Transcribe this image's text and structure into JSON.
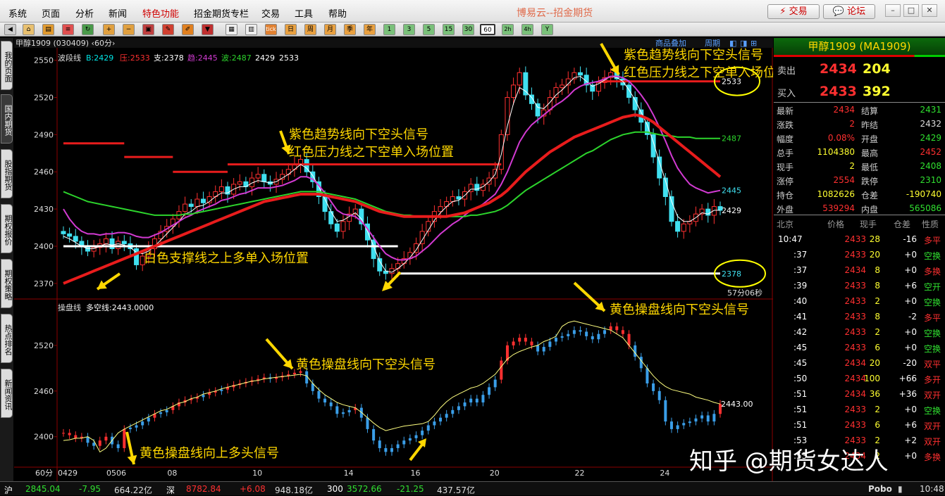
{
  "menu": {
    "items": [
      "系统",
      "页面",
      "分析",
      "新闻",
      "特色功能",
      "招金期货专栏",
      "交易",
      "工具",
      "帮助"
    ],
    "app_title": "博易云--招金期货",
    "trade_button": "交易",
    "forum_button": "论坛"
  },
  "toolbar": {
    "period_buttons": [
      "1",
      "3",
      "5",
      "15",
      "30",
      "60",
      "2h",
      "4h",
      "Y"
    ],
    "tick_button": "tick",
    "day_button": "日",
    "week_button": "周",
    "month_button": "月",
    "season_button": "季",
    "year_button": "年"
  },
  "sidebar": {
    "tabs": [
      "我的页面",
      "国内期货",
      "股指期货",
      "期权报价",
      "期权策略",
      "热点排名",
      "新闻资讯"
    ]
  },
  "chart": {
    "main_title": "甲醇1909 (030409) ‹60分›",
    "main_indicator": {
      "name": "波段线",
      "items": [
        {
          "label": "B:2429",
          "color": "#00e5e5"
        },
        {
          "label": "压:2533",
          "color": "#ff3030"
        },
        {
          "label": "支:2378",
          "color": "#ffffff"
        },
        {
          "label": "趋:2445",
          "color": "#d23ad2"
        },
        {
          "label": "波:2487",
          "color": "#2cd42c"
        },
        {
          "label": "2429",
          "color": "#ffffff"
        },
        {
          "label": "2533",
          "color": "#ffffff"
        }
      ]
    },
    "overlay_links": [
      "商品叠加",
      "周期"
    ],
    "sub_indicator": {
      "name": "操盘线",
      "items": [
        {
          "label": "多空线:2443.0000",
          "color": "#ffffff"
        }
      ]
    },
    "countdown": "57分06秒",
    "period_label": "60分",
    "main_axis_ticks": [
      2550,
      2520,
      2490,
      2460,
      2430,
      2400,
      2370
    ],
    "sub_axis_ticks": [
      2520,
      2460,
      2400
    ],
    "x_labels": [
      "0429",
      "0506",
      "08",
      "10",
      "14",
      "16",
      "20",
      "22",
      "24"
    ],
    "right_labels": {
      "resistance": "2533",
      "wave": "2487",
      "trend": "2445",
      "price": "2429",
      "support": "2378",
      "sub_line": "2443.00"
    },
    "annotations": [
      {
        "text": "紫色趋势线向下空头信号",
        "color": "#ffd700"
      },
      {
        "text": "红色压力线之下空单入场位置",
        "color": "#ffd700"
      },
      {
        "text": "白色支撑线之上多单入场位置",
        "color": "#ffd700"
      },
      {
        "text": "紫色趋势线向下空头信号",
        "color": "#ffd700"
      },
      {
        "text": "红色压力线之下空单入场位置",
        "color": "#ffd700"
      },
      {
        "text": "黄色操盘线向下空头信号",
        "color": "#ffd700"
      },
      {
        "text": "黄色操盘线向下空头信号",
        "color": "#ffd700"
      },
      {
        "text": "黄色操盘线向上多头信号",
        "color": "#ffd700"
      }
    ]
  },
  "chart_data": {
    "type": "line",
    "title": "甲醇1909 (030409) ‹60分›",
    "xlabel": "",
    "ylabel": "",
    "ylim": [
      2358,
      2560
    ],
    "x_labels": [
      "0429",
      "0506",
      "08",
      "10",
      "14",
      "16",
      "20",
      "22",
      "24"
    ],
    "candles_close": [
      2410,
      2408,
      2404,
      2400,
      2396,
      2399,
      2402,
      2406,
      2398,
      2404,
      2402,
      2398,
      2385,
      2392,
      2398,
      2406,
      2412,
      2416,
      2422,
      2428,
      2434,
      2432,
      2438,
      2435,
      2440,
      2444,
      2448,
      2442,
      2450,
      2452,
      2448,
      2455,
      2458,
      2452,
      2450,
      2454,
      2458,
      2462,
      2466,
      2470,
      2460,
      2452,
      2440,
      2428,
      2418,
      2412,
      2420,
      2426,
      2430,
      2418,
      2405,
      2390,
      2380,
      2378,
      2382,
      2386,
      2390,
      2395,
      2402,
      2412,
      2420,
      2428,
      2432,
      2436,
      2440,
      2438,
      2444,
      2450,
      2445,
      2450,
      2455,
      2462,
      2490,
      2520,
      2530,
      2540,
      2522,
      2515,
      2505,
      2510,
      2520,
      2528,
      2530,
      2535,
      2540,
      2538,
      2530,
      2525,
      2532,
      2536,
      2540,
      2535,
      2530,
      2520,
      2510,
      2500,
      2490,
      2472,
      2455,
      2440,
      2420,
      2412,
      2418,
      2420,
      2426,
      2430,
      2425,
      2432,
      2429
    ],
    "series": [
      {
        "name": "B",
        "color": "#ffffff",
        "values": [
          2408,
          2406,
          2403,
          2400,
          2398,
          2398,
          2400,
          2402,
          2401,
          2402,
          2401,
          2399,
          2395,
          2394,
          2396,
          2400,
          2405,
          2410,
          2415,
          2420,
          2426,
          2428,
          2432,
          2433,
          2436,
          2440,
          2443,
          2443,
          2446,
          2448,
          2448,
          2451,
          2453,
          2452,
          2451,
          2452,
          2455,
          2458,
          2462,
          2466,
          2463,
          2457,
          2448,
          2438,
          2428,
          2420,
          2421,
          2424,
          2427,
          2422,
          2412,
          2400,
          2388,
          2380,
          2379,
          2382,
          2386,
          2391,
          2397,
          2405,
          2413,
          2421,
          2427,
          2432,
          2436,
          2437,
          2441,
          2446,
          2446,
          2448,
          2452,
          2458,
          2474,
          2497,
          2515,
          2528,
          2525,
          2520,
          2512,
          2511,
          2516,
          2522,
          2526,
          2531,
          2536,
          2537,
          2533,
          2529,
          2531,
          2534,
          2537,
          2536,
          2533,
          2526,
          2518,
          2508,
          2498,
          2484,
          2468,
          2453,
          2436,
          2424,
          2420,
          2420,
          2423,
          2427,
          2426,
          2429,
          2429
        ]
      },
      {
        "name": "趋",
        "color": "#d23ad2",
        "values": [
          2430,
          2422,
          2416,
          2412,
          2410,
          2410,
          2409,
          2410,
          2410,
          2411,
          2411,
          2410,
          2408,
          2407,
          2407,
          2409,
          2411,
          2414,
          2417,
          2420,
          2423,
          2425,
          2428,
          2430,
          2432,
          2434,
          2437,
          2438,
          2440,
          2442,
          2443,
          2445,
          2447,
          2447,
          2447,
          2448,
          2449,
          2451,
          2453,
          2456,
          2456,
          2454,
          2449,
          2443,
          2436,
          2429,
          2426,
          2425,
          2424,
          2420,
          2414,
          2407,
          2400,
          2394,
          2391,
          2389,
          2389,
          2390,
          2392,
          2396,
          2400,
          2405,
          2410,
          2414,
          2418,
          2421,
          2425,
          2429,
          2431,
          2434,
          2438,
          2442,
          2450,
          2460,
          2472,
          2484,
          2492,
          2498,
          2502,
          2506,
          2510,
          2514,
          2517,
          2521,
          2526,
          2529,
          2531,
          2532,
          2533,
          2535,
          2537,
          2537,
          2536,
          2533,
          2528,
          2522,
          2515,
          2506,
          2496,
          2485,
          2473,
          2463,
          2456,
          2450,
          2447,
          2445,
          2443,
          2444,
          2445
        ]
      },
      {
        "name": "波",
        "color": "#2cd42c",
        "values": [
          2444,
          2442,
          2440,
          2438,
          2436,
          2435,
          2434,
          2433,
          2432,
          2431,
          2430,
          2429,
          2428,
          2427,
          2426,
          2425,
          2425,
          2425,
          2425,
          2425,
          2426,
          2426,
          2427,
          2428,
          2429,
          2430,
          2431,
          2432,
          2433,
          2434,
          2435,
          2436,
          2437,
          2438,
          2439,
          2440,
          2441,
          2442,
          2443,
          2444,
          2444,
          2444,
          2444,
          2443,
          2442,
          2441,
          2440,
          2439,
          2438,
          2436,
          2434,
          2432,
          2430,
          2428,
          2427,
          2426,
          2425,
          2425,
          2424,
          2424,
          2424,
          2424,
          2424,
          2424,
          2424,
          2424,
          2424,
          2425,
          2425,
          2426,
          2427,
          2428,
          2430,
          2433,
          2437,
          2441,
          2445,
          2448,
          2451,
          2454,
          2457,
          2460,
          2463,
          2466,
          2469,
          2472,
          2475,
          2477,
          2480,
          2483,
          2486,
          2488,
          2490,
          2491,
          2492,
          2492,
          2492,
          2491,
          2490,
          2489,
          2489,
          2488,
          2488,
          2488,
          2487,
          2487,
          2487,
          2487,
          2487
        ]
      },
      {
        "name": "red_band",
        "color": "#e81c1c",
        "values": [
          2370,
          2372,
          2374,
          2376,
          2378,
          2380,
          2382,
          2384,
          2386,
          2388,
          2390,
          2392,
          2394,
          2396,
          2398,
          2400,
          2402,
          2404,
          2406,
          2408,
          2410,
          2412,
          2414,
          2416,
          2418,
          2420,
          2422,
          2424,
          2426,
          2428,
          2430,
          2432,
          2434,
          2436,
          2437,
          2438,
          2439,
          2440,
          2441,
          2442,
          2442,
          2442,
          2442,
          2441,
          2440,
          2439,
          2438,
          2437,
          2436,
          2434,
          2432,
          2430,
          2428,
          2427,
          2426,
          2425,
          2424,
          2424,
          2424,
          2424,
          2424,
          2424,
          2424,
          2424,
          2425,
          2426,
          2427,
          2429,
          2431,
          2433,
          2435,
          2438,
          2441,
          2445,
          2450,
          2455,
          2460,
          2464,
          2468,
          2472,
          2476,
          2479,
          2482,
          2485,
          2488,
          2490,
          2492,
          2494,
          2496,
          2498,
          2500,
          2502,
          2504,
          2505,
          2506,
          2505,
          2503,
          2500,
          2496,
          2492,
          2488,
          2484,
          2480,
          2476,
          2472,
          2468,
          2464,
          2460,
          2456
        ]
      }
    ],
    "resistance_levels": [
      {
        "from": 0,
        "to": 10,
        "value": 2483
      },
      {
        "from": 10,
        "to": 18,
        "value": 2472
      },
      {
        "from": 18,
        "to": 27,
        "value": 2460
      },
      {
        "from": 27,
        "to": 72,
        "value": 2466
      },
      {
        "from": 88,
        "to": 108,
        "value": 2533
      }
    ],
    "support_levels": [
      {
        "from": 0,
        "to": 55,
        "value": 2400
      },
      {
        "from": 55,
        "to": 108,
        "value": 2378
      }
    ],
    "sub_ylim": [
      2360,
      2580
    ],
    "sub_close": [
      2405,
      2402,
      2398,
      2400,
      2392,
      2388,
      2395,
      2400,
      2390,
      2385,
      2410,
      2412,
      2415,
      2420,
      2425,
      2430,
      2432,
      2435,
      2440,
      2445,
      2448,
      2450,
      2452,
      2455,
      2458,
      2460,
      2462,
      2465,
      2468,
      2470,
      2472,
      2474,
      2476,
      2478,
      2476,
      2478,
      2480,
      2482,
      2484,
      2486,
      2470,
      2460,
      2450,
      2445,
      2440,
      2430,
      2432,
      2435,
      2438,
      2425,
      2410,
      2395,
      2385,
      2380,
      2385,
      2390,
      2395,
      2398,
      2402,
      2408,
      2415,
      2420,
      2425,
      2430,
      2435,
      2440,
      2445,
      2450,
      2445,
      2455,
      2465,
      2475,
      2500,
      2520,
      2525,
      2530,
      2525,
      2520,
      2512,
      2518,
      2525,
      2530,
      2532,
      2535,
      2540,
      2538,
      2532,
      2528,
      2535,
      2540,
      2545,
      2540,
      2535,
      2520,
      2505,
      2490,
      2470,
      2460,
      2448,
      2420,
      2410,
      2415,
      2418,
      2420,
      2424,
      2428,
      2420,
      2430,
      2443
    ],
    "sub_line": [
      2395,
      2396,
      2398,
      2398,
      2400,
      2395,
      2380,
      2385,
      2395,
      2405,
      2410,
      2414,
      2418,
      2422,
      2426,
      2430,
      2434,
      2436,
      2440,
      2444,
      2446,
      2450,
      2452,
      2456,
      2458,
      2460,
      2463,
      2465,
      2467,
      2469,
      2471,
      2473,
      2474,
      2476,
      2477,
      2478,
      2479,
      2480,
      2481,
      2482,
      2480,
      2470,
      2462,
      2455,
      2450,
      2445,
      2442,
      2440,
      2438,
      2432,
      2425,
      2418,
      2412,
      2408,
      2410,
      2412,
      2414,
      2415,
      2416,
      2417,
      2420,
      2428,
      2438,
      2446,
      2452,
      2456,
      2460,
      2464,
      2466,
      2470,
      2476,
      2482,
      2492,
      2502,
      2508,
      2512,
      2515,
      2518,
      2520,
      2525,
      2528,
      2532,
      2545,
      2550,
      2552,
      2550,
      2548,
      2546,
      2544,
      2542,
      2540,
      2535,
      2530,
      2520,
      2510,
      2500,
      2490,
      2480,
      2472,
      2466,
      2462,
      2460,
      2458,
      2456,
      2452,
      2450,
      2448,
      2445,
      2443
    ]
  },
  "quote": {
    "header": "甲醇1909 (MA1909)",
    "sell_label": "卖出",
    "sell_price": "2434",
    "sell_vol": "204",
    "buy_label": "买入",
    "buy_price": "2433",
    "buy_vol": "392",
    "stats": [
      {
        "l1": "最新",
        "v1": "2434",
        "c1": "#ff3030",
        "l2": "结算",
        "v2": "2431",
        "c2": "#30e030"
      },
      {
        "l1": "涨跌",
        "v1": "2",
        "c1": "#ff3030",
        "l2": "昨结",
        "v2": "2432",
        "c2": "#dddddd"
      },
      {
        "l1": "幅度",
        "v1": "0.08%",
        "c1": "#ff3030",
        "l2": "开盘",
        "v2": "2429",
        "c2": "#30e030"
      },
      {
        "l1": "总手",
        "v1": "1104380",
        "c1": "#ffff30",
        "l2": "最高",
        "v2": "2452",
        "c2": "#ff3030"
      },
      {
        "l1": "现手",
        "v1": "2",
        "c1": "#ffff30",
        "l2": "最低",
        "v2": "2408",
        "c2": "#30e030"
      },
      {
        "l1": "涨停",
        "v1": "2554",
        "c1": "#ff3030",
        "l2": "跌停",
        "v2": "2310",
        "c2": "#30e030"
      },
      {
        "l1": "持仓",
        "v1": "1082626",
        "c1": "#ffff30",
        "l2": "仓差",
        "v2": "-190740",
        "c2": "#ffff30"
      },
      {
        "l1": "外盘",
        "v1": "539294",
        "c1": "#ff3030",
        "l2": "内盘",
        "v2": "565086",
        "c2": "#30e030"
      }
    ],
    "tick_headers": [
      "北京",
      "价格",
      "现手",
      "仓差",
      "性质"
    ],
    "ticks": [
      {
        "t": "10:47",
        "p": "2433",
        "v": "28",
        "d": "-16",
        "n": "多平",
        "nc": "#ff3030"
      },
      {
        "t": ":37",
        "p": "2433",
        "v": "20",
        "d": "+0",
        "n": "空换",
        "nc": "#30e030"
      },
      {
        "t": ":37",
        "p": "2434",
        "v": "8",
        "d": "+0",
        "n": "多换",
        "nc": "#ff3030"
      },
      {
        "t": ":39",
        "p": "2433",
        "v": "8",
        "d": "+6",
        "n": "空开",
        "nc": "#30e030"
      },
      {
        "t": ":40",
        "p": "2433",
        "v": "2",
        "d": "+0",
        "n": "空换",
        "nc": "#30e030"
      },
      {
        "t": ":41",
        "p": "2433",
        "v": "8",
        "d": "-2",
        "n": "多平",
        "nc": "#ff3030"
      },
      {
        "t": ":42",
        "p": "2433",
        "v": "2",
        "d": "+0",
        "n": "空换",
        "nc": "#30e030"
      },
      {
        "t": ":45",
        "p": "2433",
        "v": "6",
        "d": "+0",
        "n": "空换",
        "nc": "#30e030"
      },
      {
        "t": ":45",
        "p": "2434",
        "v": "20",
        "d": "-20",
        "n": "双平",
        "nc": "#ff3030"
      },
      {
        "t": ":50",
        "p": "2434",
        "v": "100",
        "d": "+66",
        "n": "多开",
        "nc": "#ff3030"
      },
      {
        "t": ":51",
        "p": "2434",
        "v": "36",
        "d": "+36",
        "n": "双开",
        "nc": "#ff3030"
      },
      {
        "t": ":51",
        "p": "2433",
        "v": "2",
        "d": "+0",
        "n": "空换",
        "nc": "#30e030"
      },
      {
        "t": ":51",
        "p": "2433",
        "v": "6",
        "d": "+6",
        "n": "双开",
        "nc": "#ff3030"
      },
      {
        "t": ":53",
        "p": "2433",
        "v": "2",
        "d": "+2",
        "n": "双开",
        "nc": "#ff3030"
      },
      {
        "t": ":53",
        "p": "2434",
        "v": "2",
        "d": "+0",
        "n": "多换",
        "nc": "#ff3030"
      }
    ],
    "side_label": "笔"
  },
  "status": {
    "sh_label": "沪",
    "sh_index": "2845.04",
    "sh_change": "-7.95",
    "sh_amount": "664.22亿",
    "sz_label": "深",
    "sz_index": "8782.84",
    "sz_change": "+6.08",
    "sz_amount": "948.18亿",
    "hs_label": "300",
    "hs_index": "3572.66",
    "hs_change": "-21.25",
    "hs_amount": "437.57亿",
    "brand": "Pobo",
    "clock": "10:48"
  },
  "watermark": "知乎 @期货女达人"
}
